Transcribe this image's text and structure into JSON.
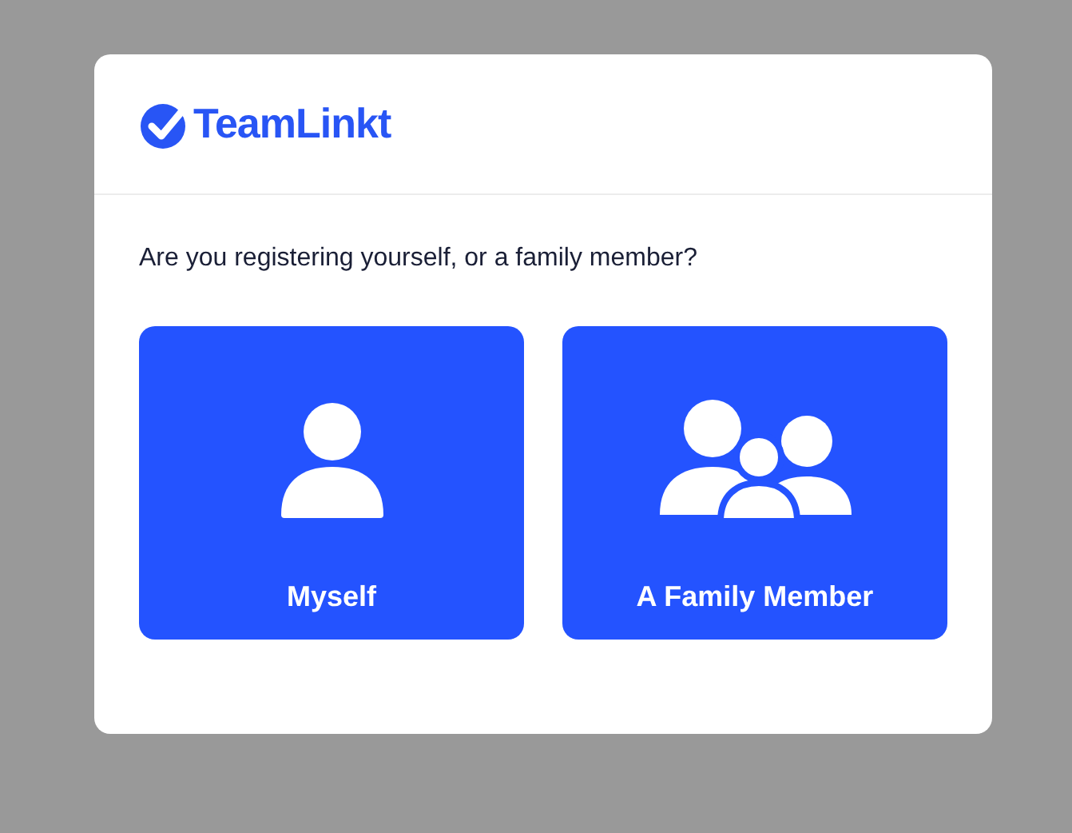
{
  "logo": {
    "text": "TeamLinkt"
  },
  "question": "Are you registering yourself, or a family member?",
  "options": [
    {
      "kind": "single",
      "label": "Myself"
    },
    {
      "kind": "family",
      "label": "A Family Member"
    }
  ]
}
